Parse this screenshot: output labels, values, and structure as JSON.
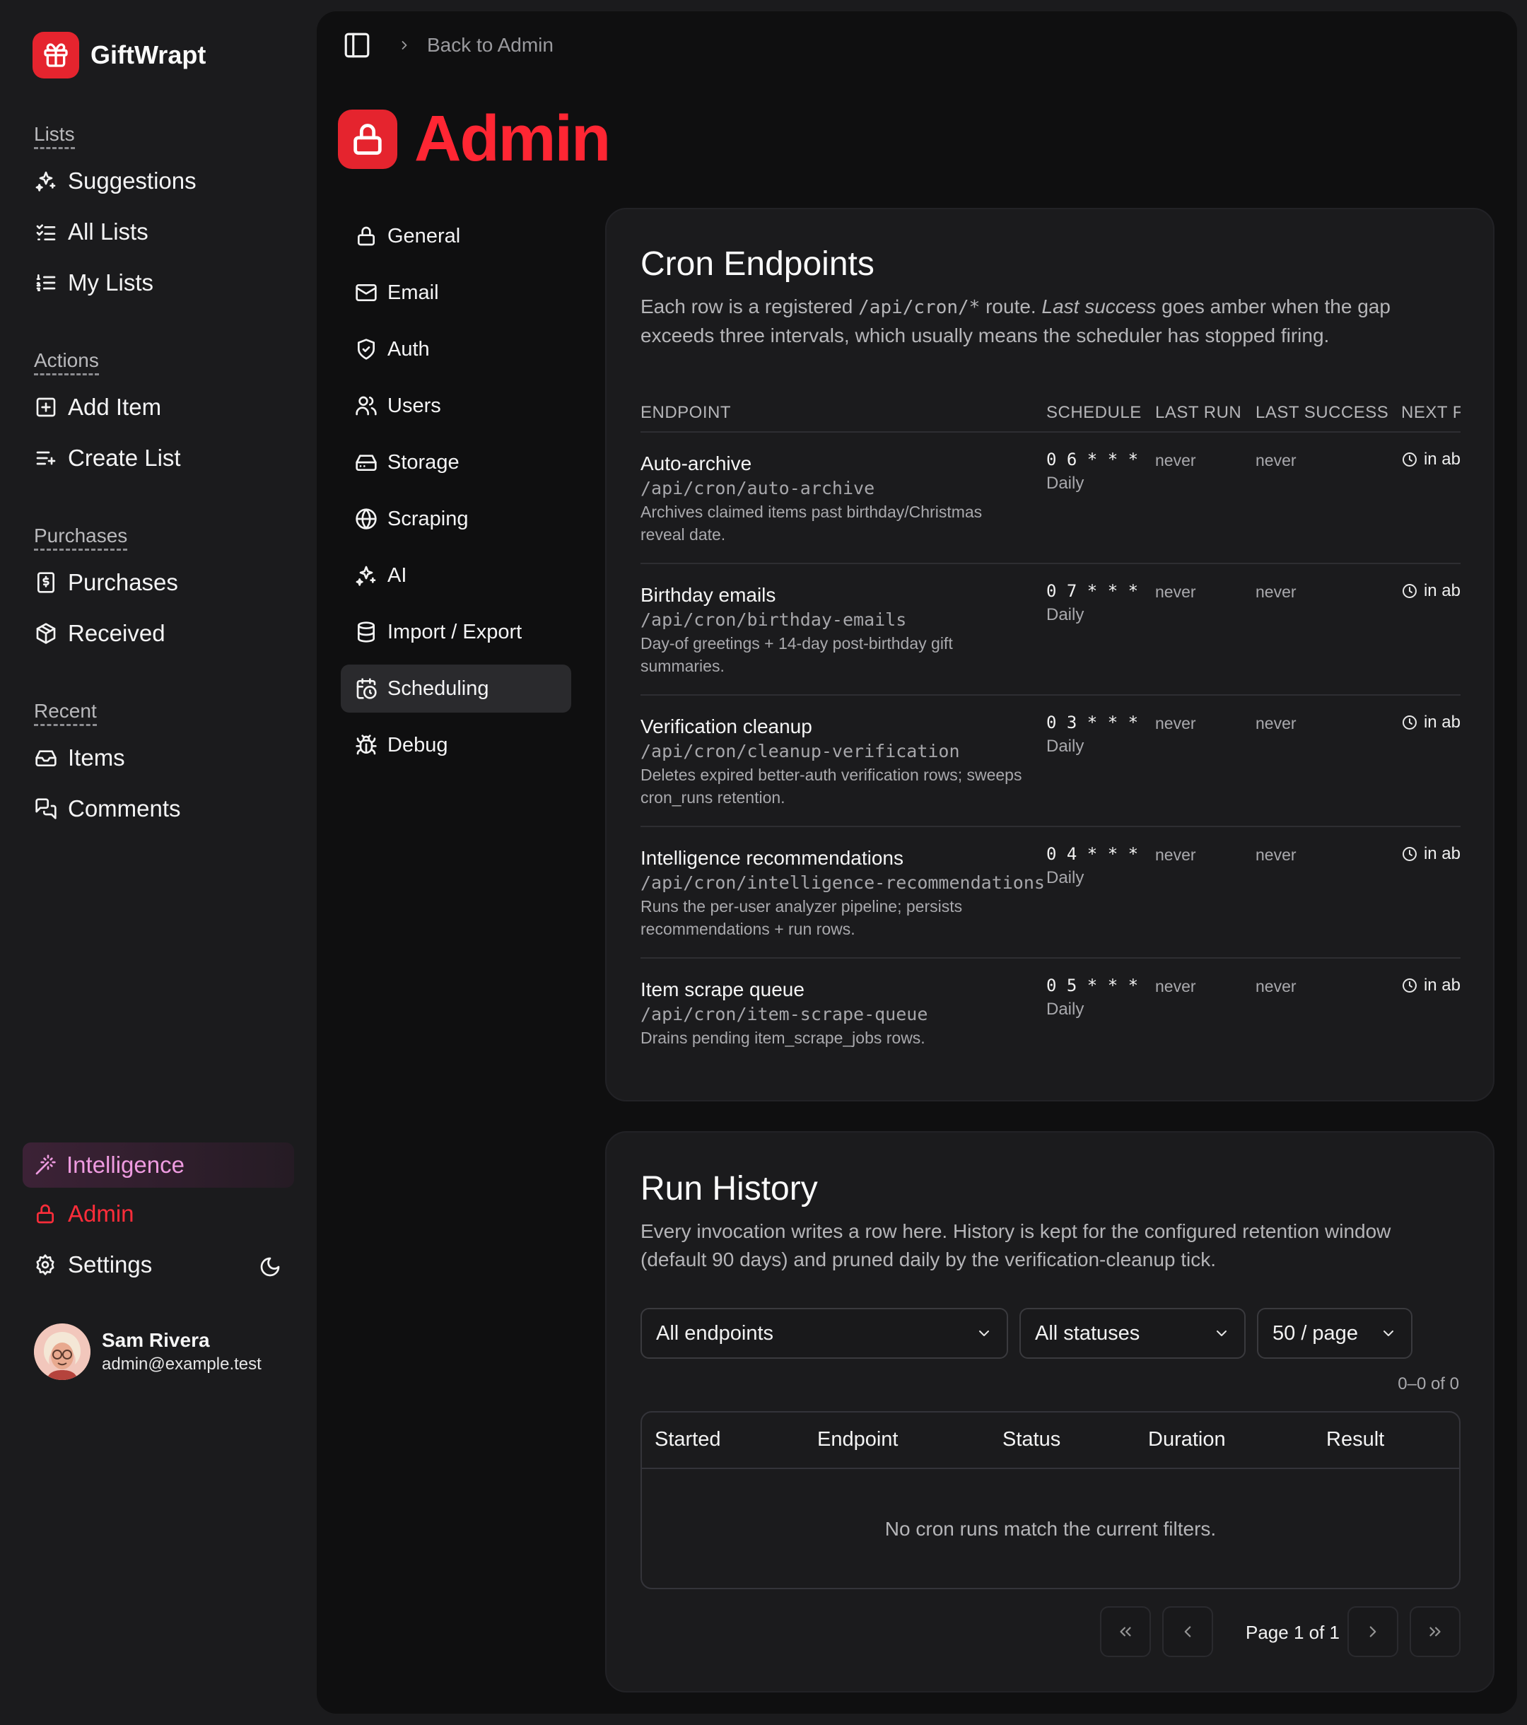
{
  "app": {
    "name": "GiftWrapt"
  },
  "sidebar": {
    "groups": [
      {
        "label": "Lists",
        "items": [
          {
            "label": "Suggestions",
            "icon": "sparkles-icon"
          },
          {
            "label": "All Lists",
            "icon": "list-checks-icon"
          },
          {
            "label": "My Lists",
            "icon": "list-ordered-icon"
          }
        ]
      },
      {
        "label": "Actions",
        "items": [
          {
            "label": "Add Item",
            "icon": "square-plus-icon"
          },
          {
            "label": "Create List",
            "icon": "list-plus-icon"
          }
        ]
      },
      {
        "label": "Purchases",
        "items": [
          {
            "label": "Purchases",
            "icon": "receipt-icon"
          },
          {
            "label": "Received",
            "icon": "package-icon"
          }
        ]
      },
      {
        "label": "Recent",
        "items": [
          {
            "label": "Items",
            "icon": "inbox-icon"
          },
          {
            "label": "Comments",
            "icon": "messages-icon"
          }
        ]
      }
    ],
    "bottom": {
      "intelligence": "Intelligence",
      "admin": "Admin",
      "settings": "Settings"
    },
    "user": {
      "name": "Sam Rivera",
      "email": "admin@example.test"
    }
  },
  "topbar": {
    "back": "Back to Admin"
  },
  "page": {
    "title": "Admin"
  },
  "subnav": {
    "items": [
      {
        "label": "General",
        "icon": "lock-icon"
      },
      {
        "label": "Email",
        "icon": "mail-icon"
      },
      {
        "label": "Auth",
        "icon": "shield-icon"
      },
      {
        "label": "Users",
        "icon": "users-icon"
      },
      {
        "label": "Storage",
        "icon": "hard-drive-icon"
      },
      {
        "label": "Scraping",
        "icon": "globe-icon"
      },
      {
        "label": "AI",
        "icon": "sparkles-icon"
      },
      {
        "label": "Import / Export",
        "icon": "database-icon"
      },
      {
        "label": "Scheduling",
        "icon": "calendar-clock-icon"
      },
      {
        "label": "Debug",
        "icon": "bug-icon"
      }
    ],
    "active": "Scheduling"
  },
  "cron": {
    "title": "Cron Endpoints",
    "desc_a": "Each row is a registered ",
    "desc_code": "/api/cron/*",
    "desc_b": " route. ",
    "desc_em": "Last success",
    "desc_c": " goes amber when the gap exceeds three intervals, which usually means the scheduler has stopped firing.",
    "columns": {
      "endpoint": "ENDPOINT",
      "schedule": "SCHEDULE",
      "last_run": "LAST RUN",
      "last_success": "LAST SUCCESS",
      "next": "NEXT F"
    },
    "rows": [
      {
        "name": "Auto-archive",
        "path": "/api/cron/auto-archive",
        "note": "Archives claimed items past birthday/Christmas reveal date.",
        "cron": "0 6 * * *",
        "freq": "Daily",
        "last_run": "never",
        "last_success": "never",
        "next": "in ab"
      },
      {
        "name": "Birthday emails",
        "path": "/api/cron/birthday-emails",
        "note": "Day-of greetings + 14-day post-birthday gift summaries.",
        "cron": "0 7 * * *",
        "freq": "Daily",
        "last_run": "never",
        "last_success": "never",
        "next": "in ab"
      },
      {
        "name": "Verification cleanup",
        "path": "/api/cron/cleanup-verification",
        "note": "Deletes expired better-auth verification rows; sweeps cron_runs retention.",
        "cron": "0 3 * * *",
        "freq": "Daily",
        "last_run": "never",
        "last_success": "never",
        "next": "in ab"
      },
      {
        "name": "Intelligence recommendations",
        "path": "/api/cron/intelligence-recommendations",
        "note": "Runs the per-user analyzer pipeline; persists recommendations + run rows.",
        "cron": "0 4 * * *",
        "freq": "Daily",
        "last_run": "never",
        "last_success": "never",
        "next": "in ab"
      },
      {
        "name": "Item scrape queue",
        "path": "/api/cron/item-scrape-queue",
        "note": "Drains pending item_scrape_jobs rows.",
        "cron": "0 5 * * *",
        "freq": "Daily",
        "last_run": "never",
        "last_success": "never",
        "next": "in ab"
      }
    ]
  },
  "history": {
    "title": "Run History",
    "desc": "Every invocation writes a row here. History is kept for the configured retention window (default 90 days) and pruned daily by the verification-cleanup tick.",
    "filters": {
      "endpoint": "All endpoints",
      "status": "All statuses",
      "page_size": "50 / page"
    },
    "count": "0–0 of 0",
    "columns": {
      "started": "Started",
      "endpoint": "Endpoint",
      "status": "Status",
      "duration": "Duration",
      "result": "Result"
    },
    "empty": "No cron runs match the current filters.",
    "page_label": "Page 1 of 1"
  },
  "colors": {
    "brand": "#e5242e",
    "admin_title": "#ff2633",
    "intelligence": "#ee9be0"
  }
}
